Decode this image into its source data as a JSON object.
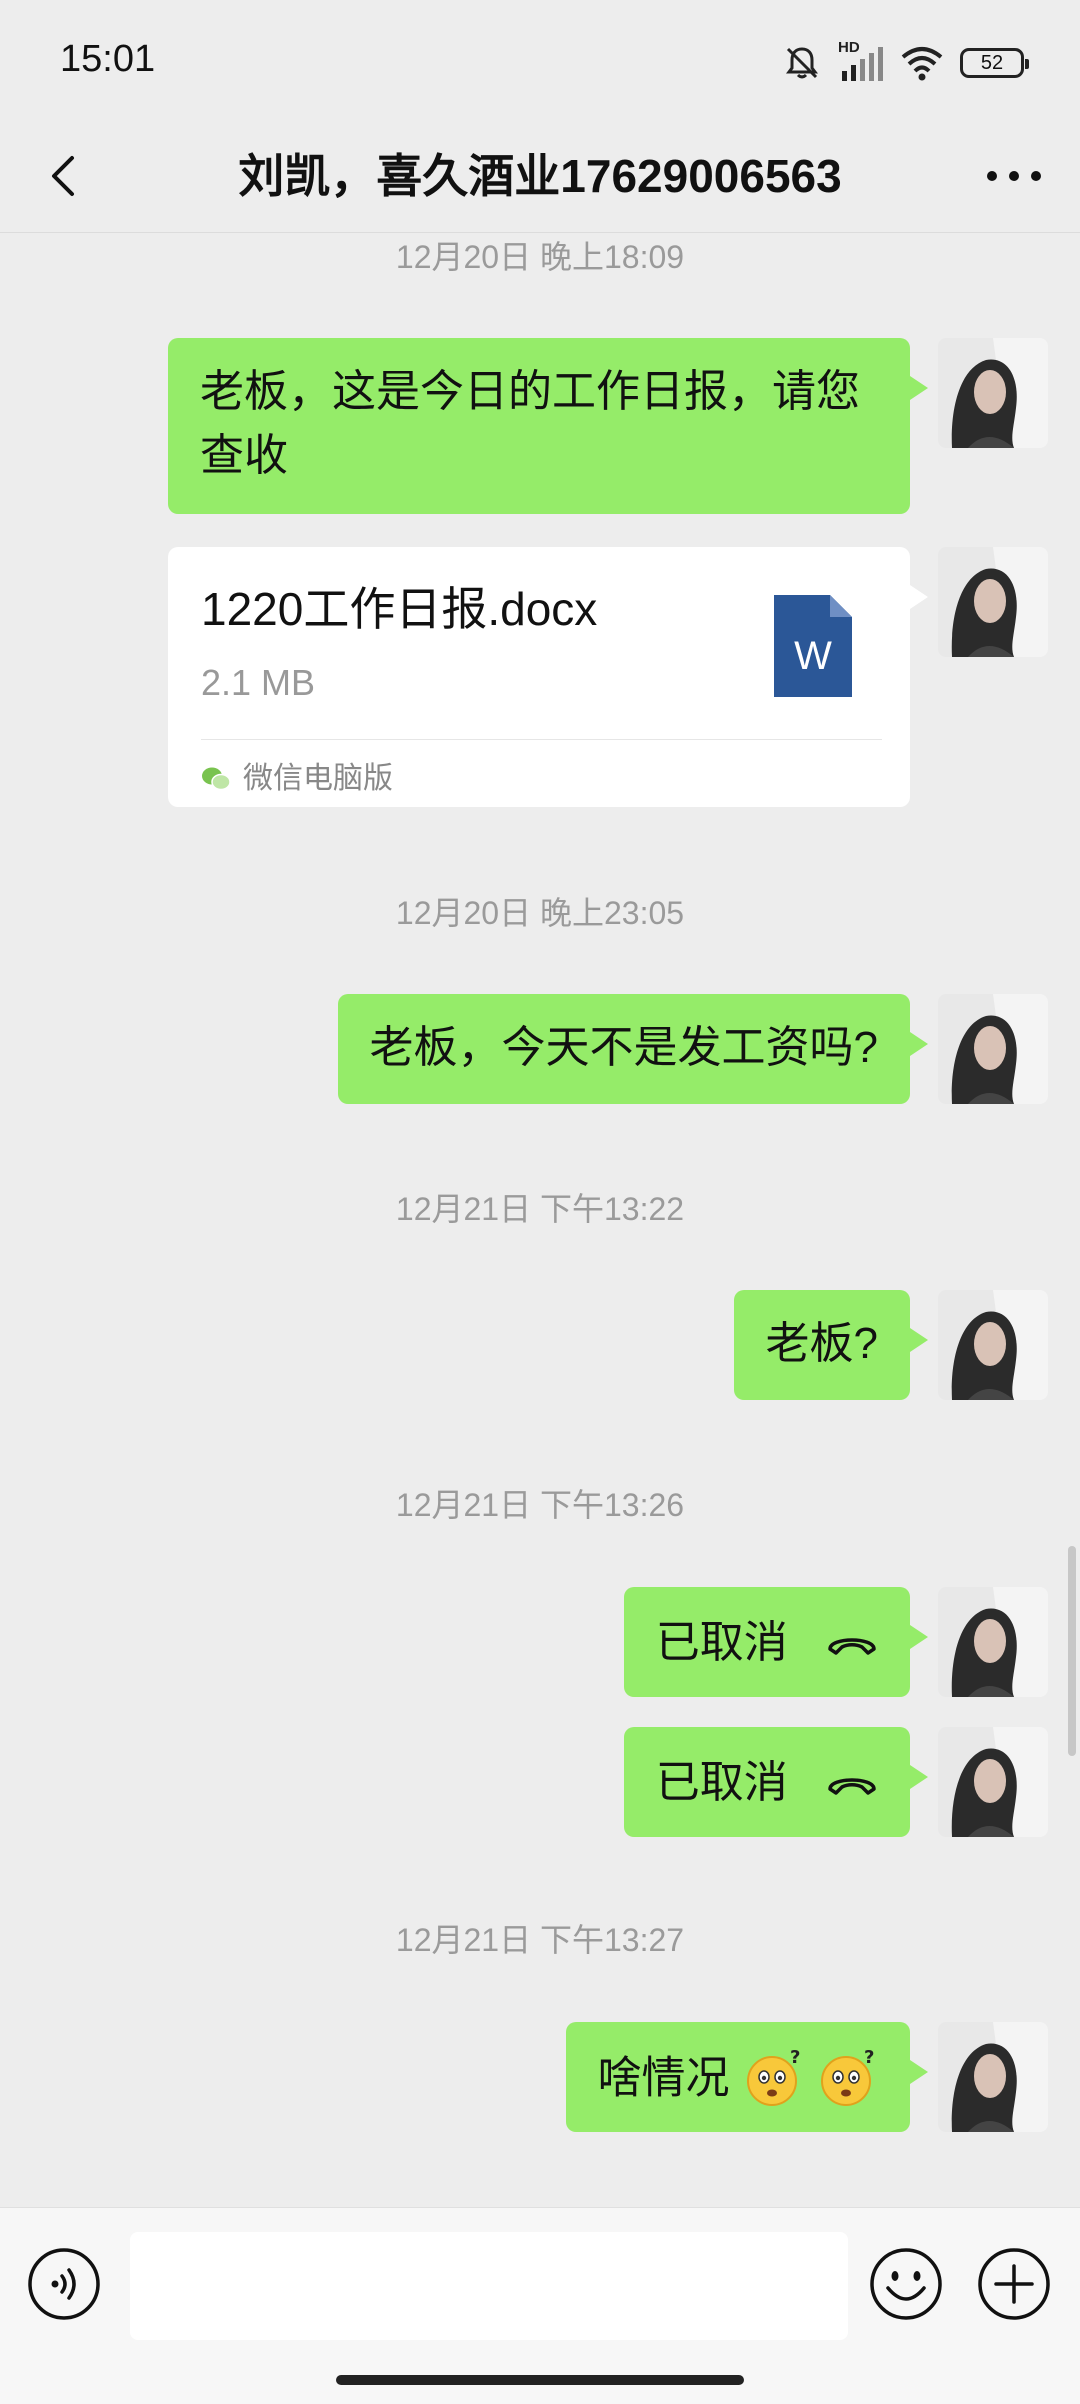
{
  "status_bar": {
    "time": "15:01",
    "battery": "52",
    "network_label": "HD",
    "icons": [
      "mute-bell-icon",
      "signal-icon",
      "wifi-icon",
      "battery-icon"
    ]
  },
  "nav": {
    "title": "刘凯，喜久酒业17629006563",
    "back_icon": "chevron-left-icon",
    "more_icon": "more-dots-icon"
  },
  "messages": [
    {
      "type": "timestamp",
      "text": "12月20日 晚上18:09"
    },
    {
      "type": "text",
      "sender": "me",
      "lines": [
        "老板，这是今日的工作日报，请您",
        "查收"
      ]
    },
    {
      "type": "file",
      "sender": "me",
      "file_name": "1220工作日报.docx",
      "file_size": "2.1 MB",
      "file_icon_letter": "W",
      "source": "微信电脑版"
    },
    {
      "type": "timestamp",
      "text": "12月20日 晚上23:05"
    },
    {
      "type": "text",
      "sender": "me",
      "text": "老板，今天不是发工资吗?"
    },
    {
      "type": "timestamp",
      "text": "12月21日 下午13:22"
    },
    {
      "type": "text",
      "sender": "me",
      "text": "老板?"
    },
    {
      "type": "timestamp",
      "text": "12月21日 下午13:26"
    },
    {
      "type": "call",
      "sender": "me",
      "text": "已取消",
      "icon": "hangup-phone-icon"
    },
    {
      "type": "call",
      "sender": "me",
      "text": "已取消",
      "icon": "hangup-phone-icon"
    },
    {
      "type": "timestamp",
      "text": "12月21日 下午13:27"
    },
    {
      "type": "text",
      "sender": "me",
      "text": "啥情况",
      "emojis": [
        "confused-face-emoji",
        "confused-face-emoji"
      ]
    }
  ],
  "input_bar": {
    "placeholder": "",
    "icons": [
      "voice-icon",
      "emoji-icon",
      "plus-icon"
    ]
  },
  "colors": {
    "background": "#ededed",
    "sent_bubble": "#95ec69",
    "file_bubble": "#ffffff",
    "timestamp_text": "#9a9a9a",
    "word_icon": "#2b5797"
  }
}
